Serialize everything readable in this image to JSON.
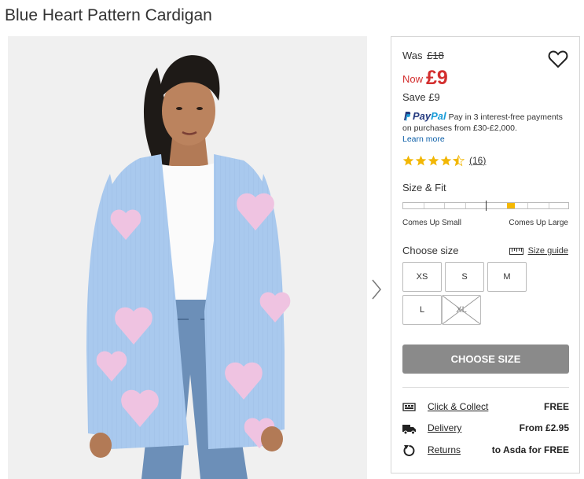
{
  "product": {
    "title": "Blue Heart Pattern Cardigan"
  },
  "pricing": {
    "was_label": "Was",
    "was_value": "£18",
    "now_label": "Now",
    "now_value": "£9",
    "save_label": "Save",
    "save_value": "£9"
  },
  "paypal": {
    "brand_part1": "Pay",
    "brand_part2": "Pal",
    "text": "Pay in 3 interest-free payments on purchases from £30-£2,000.",
    "learn_more": "Learn more"
  },
  "rating": {
    "stars": 4.5,
    "count_label": "(16)"
  },
  "size_fit": {
    "title": "Size & Fit",
    "marker_position": 0.65,
    "low_label": "Comes Up Small",
    "high_label": "Comes Up Large"
  },
  "sizes": {
    "label": "Choose size",
    "guide_label": "Size guide",
    "options": [
      {
        "label": "XS",
        "available": true
      },
      {
        "label": "S",
        "available": true
      },
      {
        "label": "M",
        "available": true
      },
      {
        "label": "L",
        "available": true
      },
      {
        "label": "XL",
        "available": false
      }
    ]
  },
  "cta": {
    "label": "CHOOSE SIZE"
  },
  "services": [
    {
      "icon": "click-collect-icon",
      "label": "Click & Collect",
      "value": "FREE"
    },
    {
      "icon": "delivery-truck-icon",
      "label": "Delivery",
      "value": "From £2.95"
    },
    {
      "icon": "returns-icon",
      "label": "Returns",
      "value": "to Asda for FREE"
    }
  ],
  "colors": {
    "price_red": "#d32f2f",
    "cardigan_blue": "#a8c8ec",
    "heart_pink": "#f0c4e0",
    "fit_marker": "#f5b800",
    "cta_grey": "#8a8a8a"
  }
}
